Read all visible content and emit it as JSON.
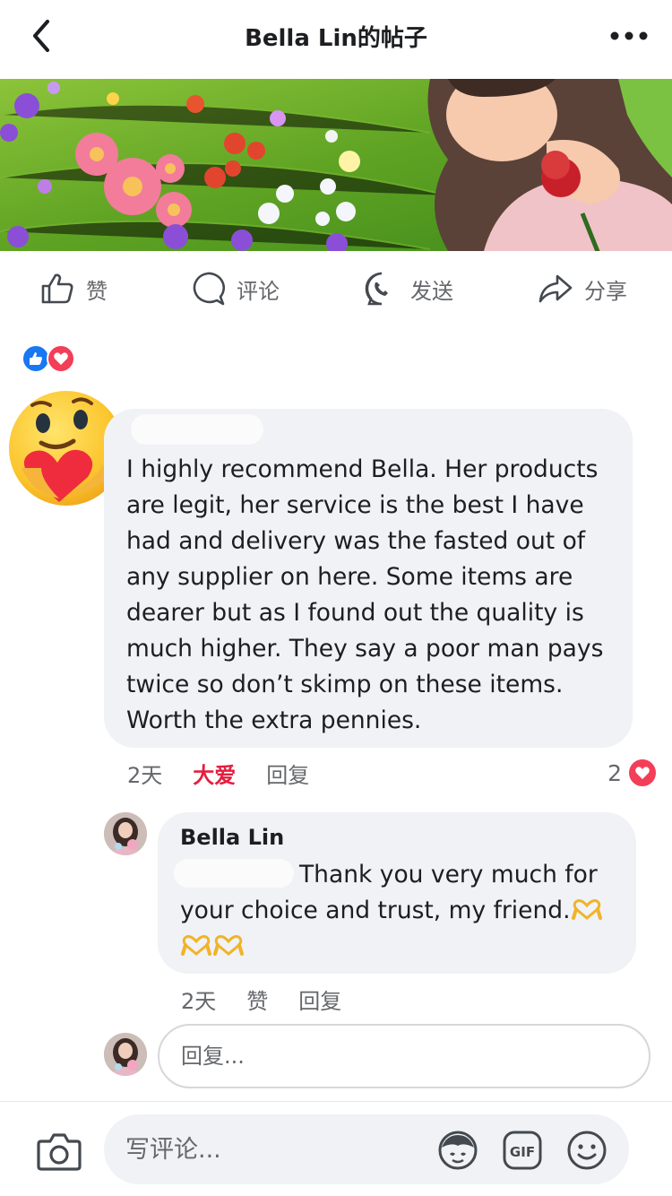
{
  "header": {
    "title": "Bella Lin的帖子"
  },
  "actions": [
    {
      "label": "赞",
      "icon": "thumbs-up-icon"
    },
    {
      "label": "评论",
      "icon": "comment-icon"
    },
    {
      "label": "发送",
      "icon": "messenger-icon"
    },
    {
      "label": "分享",
      "icon": "share-icon"
    }
  ],
  "reactions": [
    "like",
    "love"
  ],
  "comment": {
    "text": "I highly recommend Bella. Her products are legit, her service is the best I have had and delivery was the fasted out of any supplier on here. Some items are dearer but as I found out the quality is much higher. They say a poor man pays twice so don’t skimp on these items. Worth the extra pennies.",
    "time": "2天",
    "reaction_label": "大爱",
    "reply_label": "回复",
    "reaction_count": "2"
  },
  "reply": {
    "author": "Bella Lin",
    "text": "Thank you very much for your choice and trust, my friend.",
    "time": "2天",
    "like_label": "赞",
    "reply_label": "回复"
  },
  "reply_input": {
    "placeholder": "回复..."
  },
  "composer": {
    "placeholder": "写评论..."
  },
  "colors": {
    "like_blue": "#1877f2",
    "love_red": "#f33e58",
    "bubble_bg": "#f0f2f5",
    "secondary_text": "#65676b",
    "love_label": "#e41e3f"
  }
}
